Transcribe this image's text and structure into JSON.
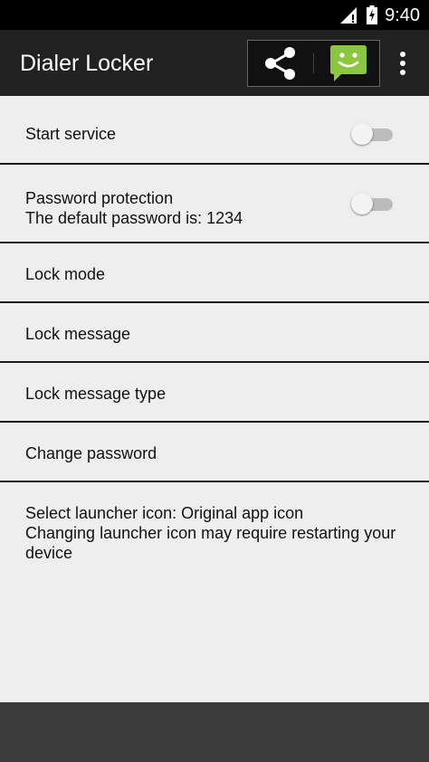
{
  "status_bar": {
    "time": "9:40",
    "signal_icon": "cell-signal-icon",
    "battery_icon": "battery-charging-icon"
  },
  "app_bar": {
    "title": "Dialer Locker",
    "actions": [
      "share-icon",
      "sms-smiley-icon",
      "more-vert-icon"
    ],
    "background": "#212121",
    "sms_icon_color": "#8dc63f"
  },
  "settings": {
    "start_service": {
      "label": "Start service",
      "enabled": false
    },
    "password_protection": {
      "label": "Password protection",
      "summary": "The default password is: 1234",
      "enabled": false
    },
    "lock_mode": {
      "label": "Lock mode"
    },
    "lock_message": {
      "label": "Lock message"
    },
    "lock_message_type": {
      "label": "Lock message type"
    },
    "change_password": {
      "label": "Change password"
    },
    "launcher_icon": {
      "label": "Select launcher icon: Original app icon",
      "summary": "Changing launcher icon may require restarting your device"
    }
  }
}
